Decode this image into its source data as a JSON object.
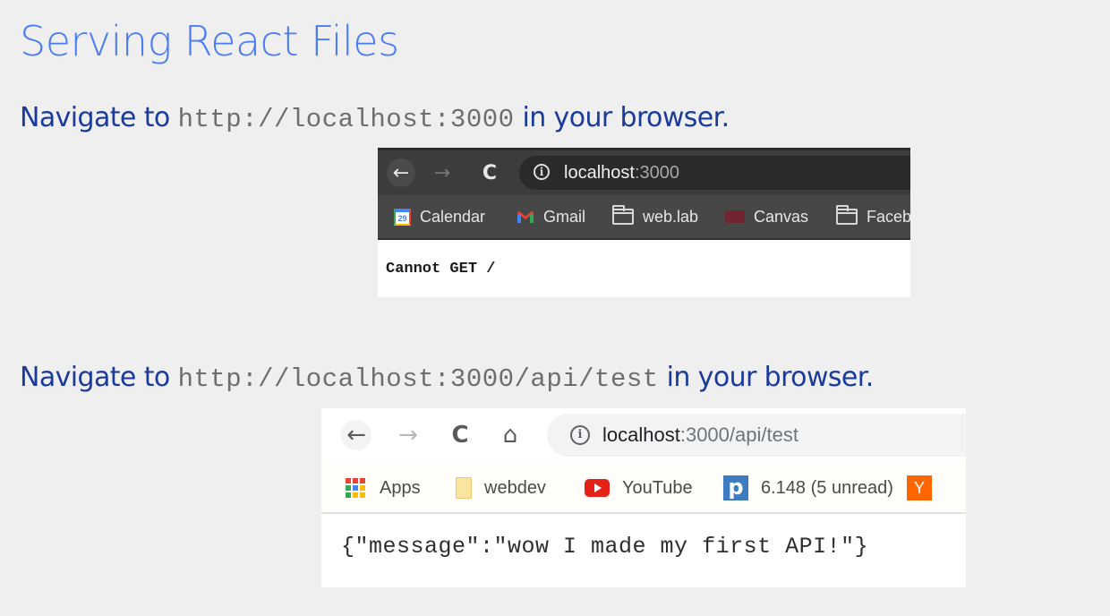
{
  "slide": {
    "title": "Serving React Files",
    "instructions": [
      {
        "prefix": "Navigate to ",
        "code": "http://localhost:3000",
        "suffix": " in your browser."
      },
      {
        "prefix": "Navigate to ",
        "code": "http://localhost:3000/api/test",
        "suffix": " in your browser."
      }
    ]
  },
  "screenshot_1": {
    "theme": "dark",
    "nav": {
      "back_icon": "arrow-left-icon",
      "back_glyph": "←",
      "forward_icon": "arrow-right-icon",
      "forward_glyph": "→",
      "reload_icon": "reload-icon",
      "reload_glyph": "C"
    },
    "omnibox": {
      "info_glyph": "i",
      "host": "localhost",
      "rest": ":3000"
    },
    "bookmarks": [
      {
        "label": "Calendar",
        "icon": "google-calendar-icon",
        "icon_text": "29"
      },
      {
        "label": "Gmail",
        "icon": "gmail-icon"
      },
      {
        "label": "web.lab",
        "icon": "folder-icon"
      },
      {
        "label": "Canvas",
        "icon": "canvas-icon"
      },
      {
        "label": "Faceb",
        "icon": "folder-icon"
      }
    ],
    "page_text": "Cannot GET /"
  },
  "screenshot_2": {
    "theme": "light",
    "nav": {
      "back_icon": "arrow-left-icon",
      "back_glyph": "←",
      "forward_icon": "arrow-right-icon",
      "forward_glyph": "→",
      "reload_icon": "reload-icon",
      "reload_glyph": "C",
      "home_icon": "home-icon",
      "home_glyph": "⌂"
    },
    "omnibox": {
      "info_glyph": "i",
      "host": "localhost",
      "rest": ":3000/api/test"
    },
    "bookmarks": [
      {
        "label": "Apps",
        "icon": "apps-grid-icon"
      },
      {
        "label": "webdev",
        "icon": "folder-icon"
      },
      {
        "label": "YouTube",
        "icon": "youtube-icon"
      },
      {
        "label": "6.148 (5 unread)",
        "icon": "piazza-icon",
        "icon_text": "p"
      },
      {
        "label": "",
        "icon": "hacker-news-icon",
        "icon_text": "Y"
      }
    ],
    "page_text": "{\"message\":\"wow I made my first API!\"}"
  },
  "colors": {
    "background": "#efefef",
    "title": "#4a7cf6",
    "instruction_text": "#1a3a9c",
    "code_text": "#6e6e6e",
    "apps_grid": [
      "#ea4335",
      "#ea4335",
      "#ea4335",
      "#34a853",
      "#4285f4",
      "#fbbc05",
      "#34a853",
      "#fbbc05",
      "#fbbc05"
    ]
  }
}
